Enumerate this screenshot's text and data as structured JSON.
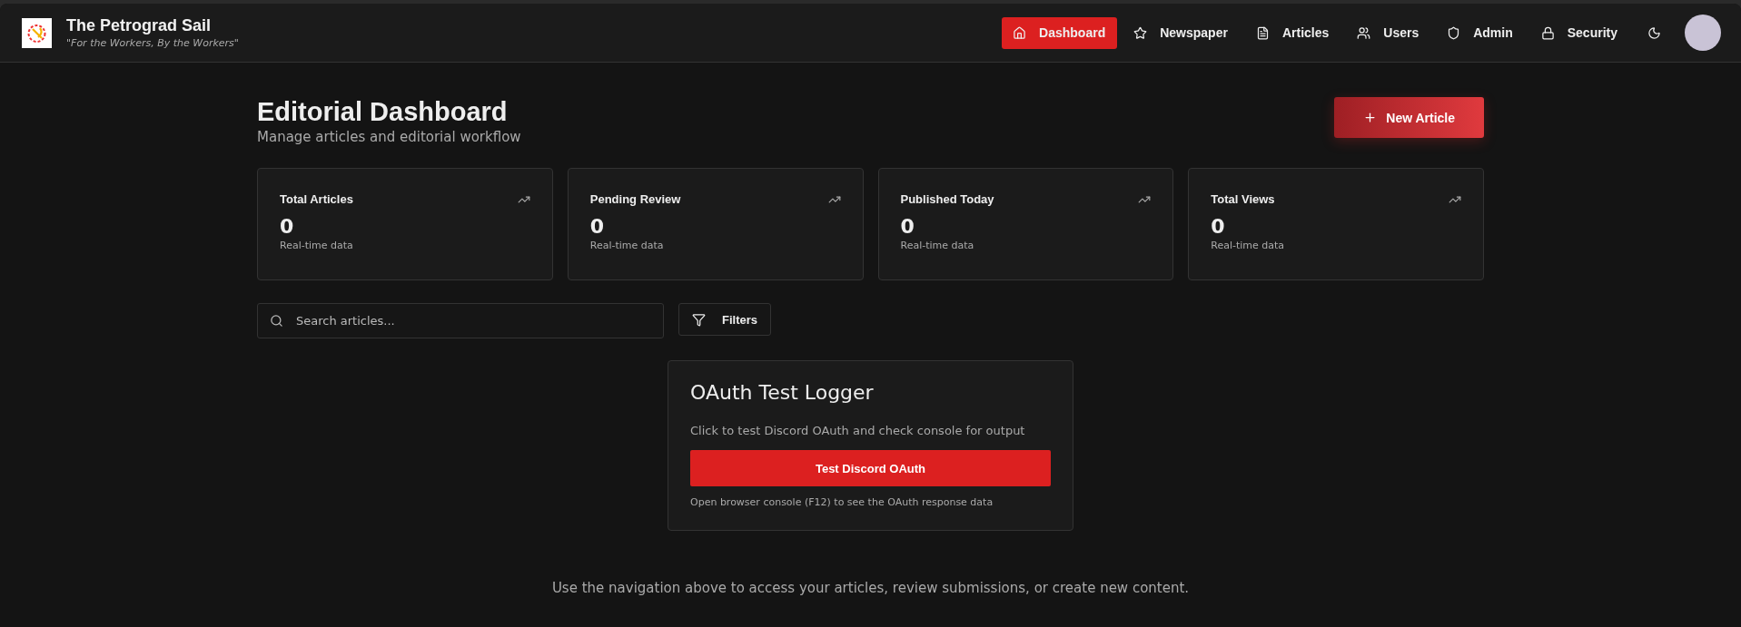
{
  "brand": {
    "title": "The Petrograd Sail",
    "tagline": "\"For the Workers, By the Workers\""
  },
  "nav": [
    {
      "label": "Dashboard",
      "selected": true
    },
    {
      "label": "Newspaper",
      "selected": false
    },
    {
      "label": "Articles",
      "selected": false
    },
    {
      "label": "Users",
      "selected": false
    },
    {
      "label": "Admin",
      "selected": false
    },
    {
      "label": "Security",
      "selected": false
    }
  ],
  "page": {
    "title": "Editorial Dashboard",
    "subtitle": "Manage articles and editorial workflow",
    "new_button": "New Article"
  },
  "stats": [
    {
      "label": "Total Articles",
      "value": "0",
      "note": "Real-time data"
    },
    {
      "label": "Pending Review",
      "value": "0",
      "note": "Real-time data"
    },
    {
      "label": "Published Today",
      "value": "0",
      "note": "Real-time data"
    },
    {
      "label": "Total Views",
      "value": "0",
      "note": "Real-time data"
    }
  ],
  "search": {
    "placeholder": "Search articles..."
  },
  "filters_button": "Filters",
  "oauth": {
    "title": "OAuth Test Logger",
    "description": "Click to test Discord OAuth and check console for output",
    "button": "Test Discord OAuth",
    "hint": "Open browser console (F12) to see the OAuth response data"
  },
  "footer": "Use the navigation above to access your articles, review submissions, or create new content."
}
